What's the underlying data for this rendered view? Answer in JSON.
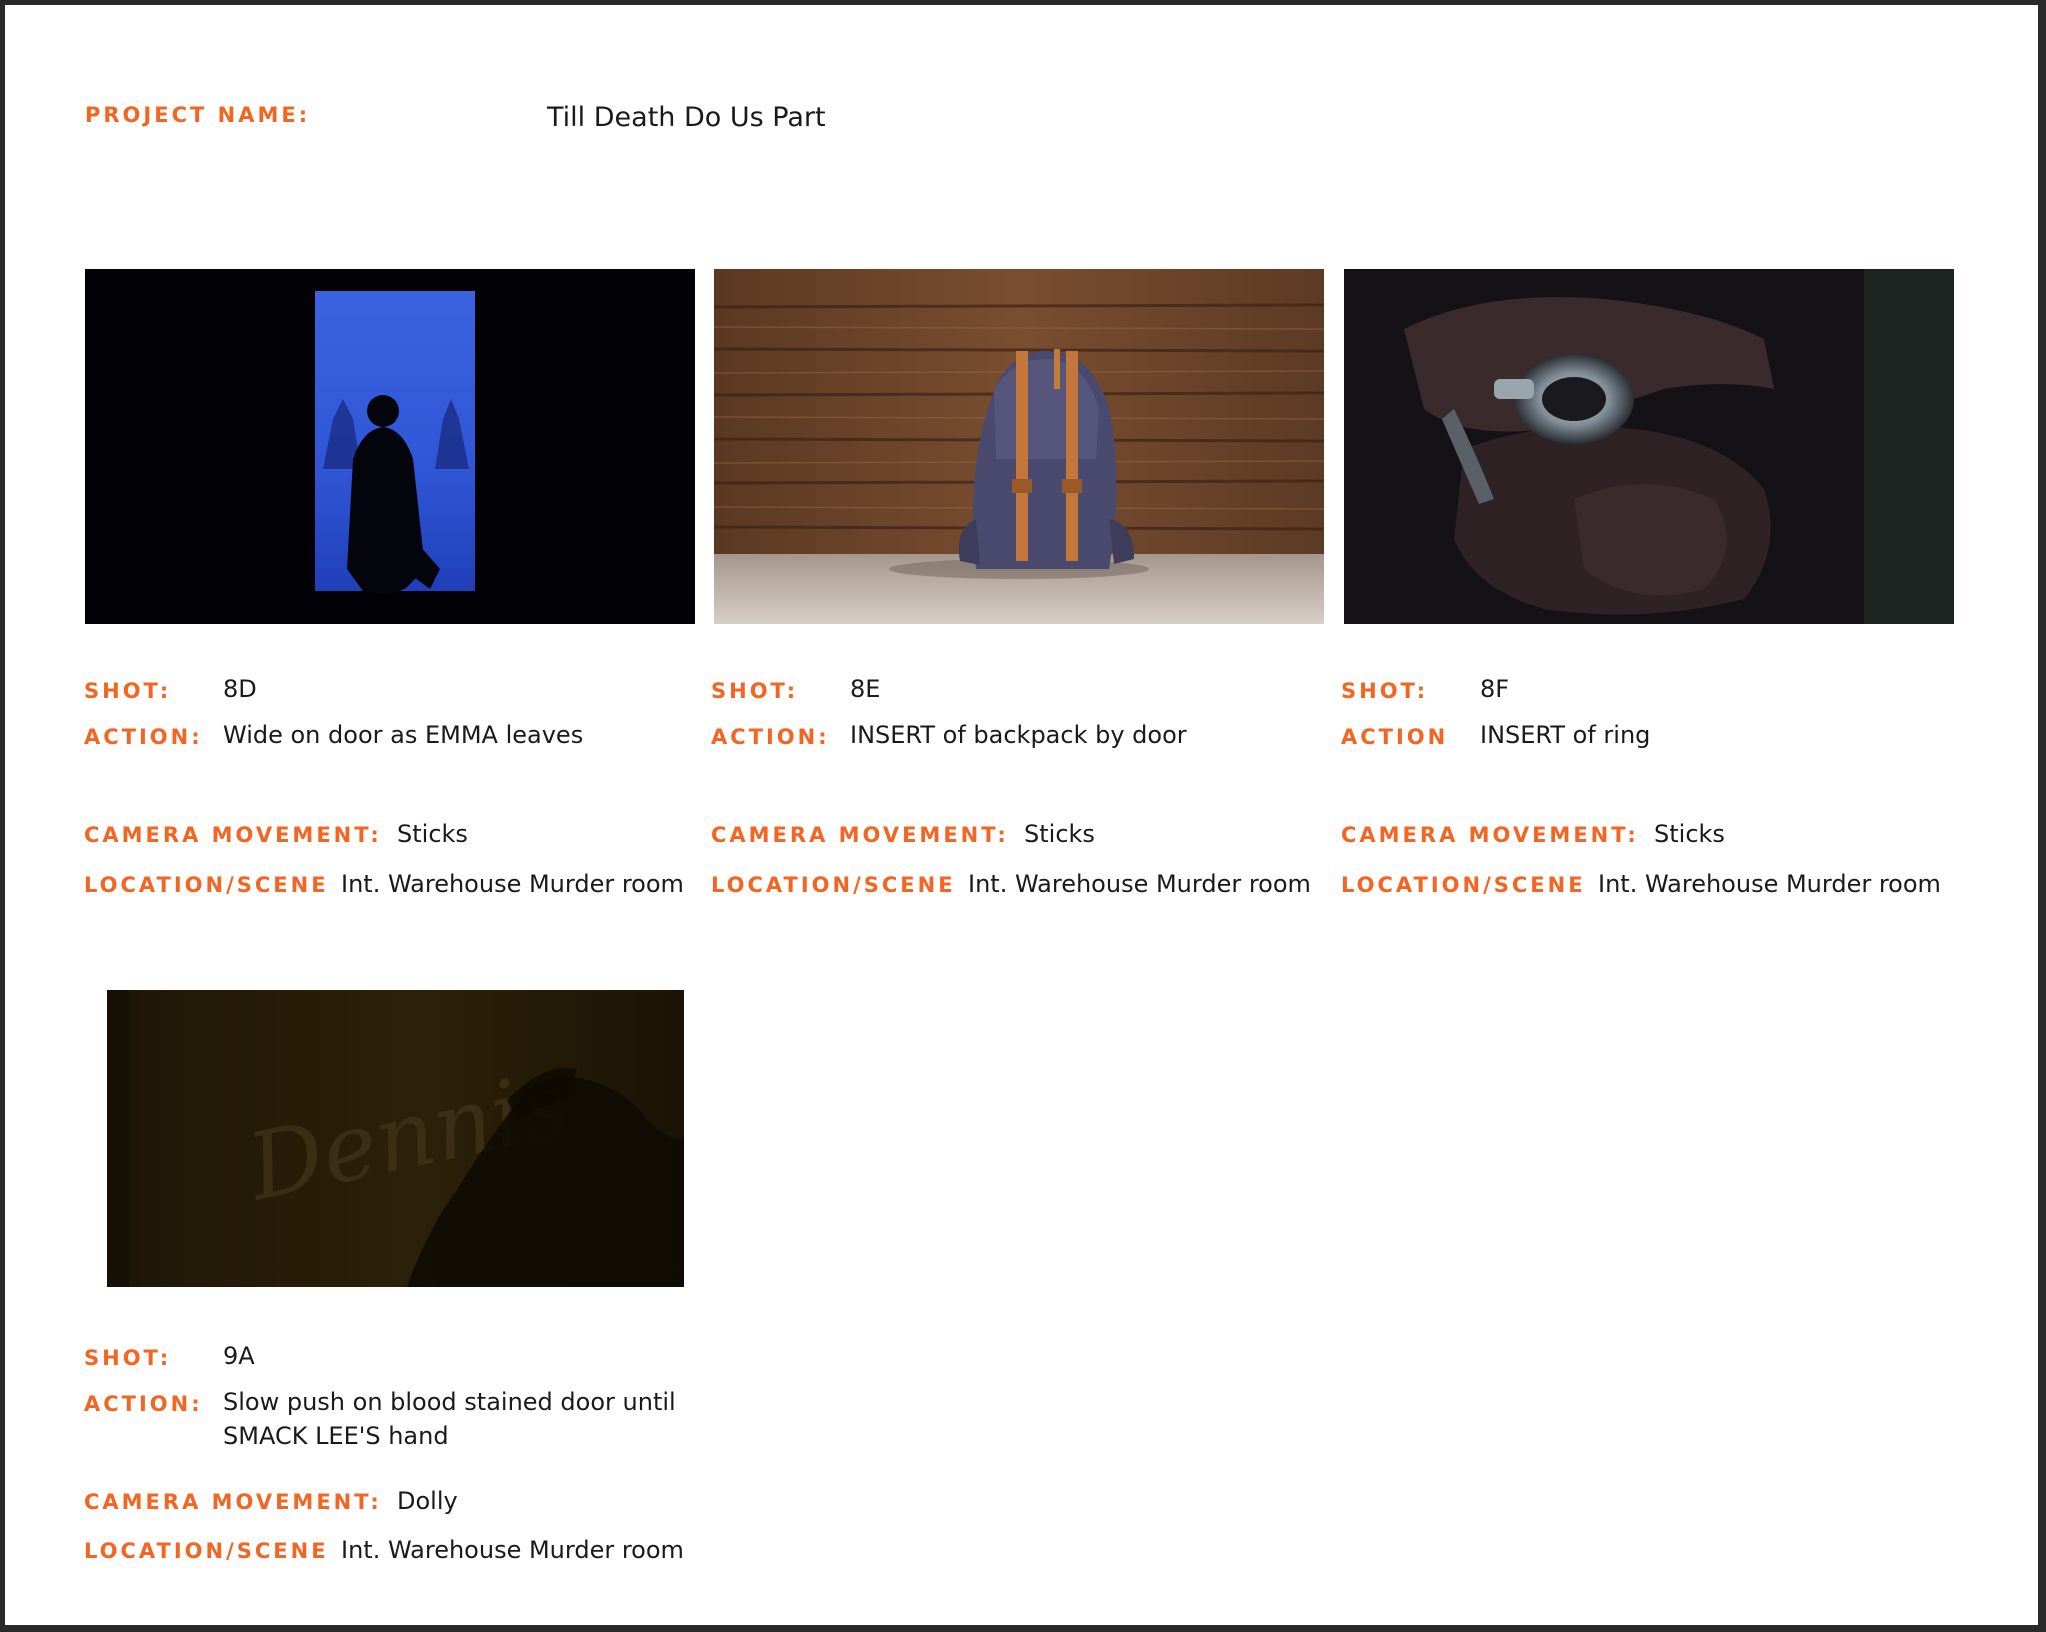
{
  "project": {
    "label": "PROJECT NAME:",
    "name": "Till Death Do Us Part"
  },
  "labels": {
    "shot": "SHOT:",
    "action_colon": "ACTION:",
    "action_plain": "ACTION",
    "camera": "CAMERA MOVEMENT:",
    "location": "LOCATION/SCENE"
  },
  "shots": [
    {
      "shot": "8D",
      "action": "Wide on door as EMMA leaves",
      "camera": "Sticks",
      "location": "Int. Warehouse Murder room",
      "image": "silhouette-in-doorway-image"
    },
    {
      "shot": "8E",
      "action": "INSERT of backpack by door",
      "camera": "Sticks",
      "location": "Int. Warehouse Murder room",
      "image": "backpack-on-floor-image"
    },
    {
      "shot": "8F",
      "action": "INSERT of ring",
      "camera": "Sticks",
      "location": "Int. Warehouse Murder room",
      "image": "hand-with-ring-image"
    },
    {
      "shot": "9A",
      "action": "Slow push on blood stained door until SMACK LEE'S hand",
      "camera": "Dolly",
      "location": "Int. Warehouse Murder room",
      "image": "hand-shadow-on-door-image",
      "door_writing": "Dennis"
    }
  ]
}
